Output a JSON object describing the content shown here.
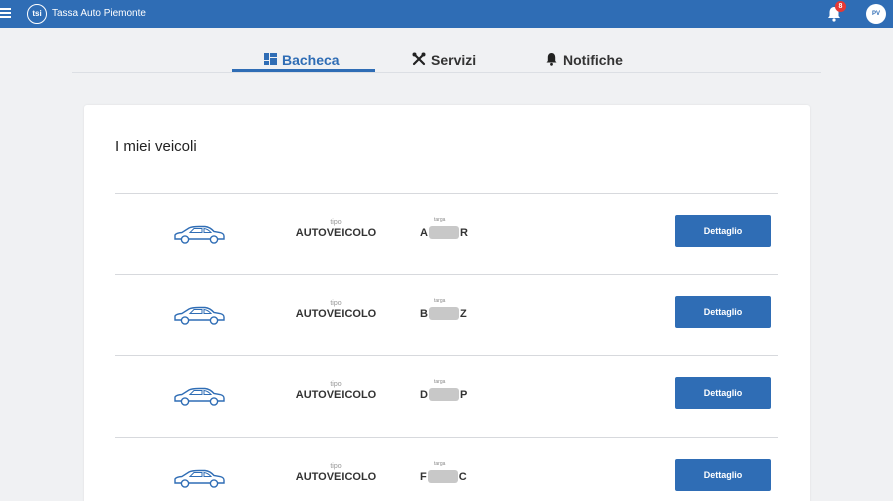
{
  "header": {
    "logo_text": "tsi",
    "app_title": "Tassa Auto Piemonte",
    "notification_count": "8",
    "avatar_initials": "PV",
    "color": "#2f6db5"
  },
  "tabs": [
    {
      "label": "Bacheca",
      "icon": "dashboard-icon",
      "active": true
    },
    {
      "label": "Servizi",
      "icon": "tools-icon",
      "active": false
    },
    {
      "label": "Notifiche",
      "icon": "bell-icon",
      "active": false
    }
  ],
  "main": {
    "title": "I miei veicoli",
    "vehicles": [
      {
        "tipo_label": "tipo",
        "tipo": "AUTOVEICOLO",
        "targa_label": "targa",
        "targa_prefix": "A",
        "targa_suffix": "R",
        "button": "Dettaglio"
      },
      {
        "tipo_label": "tipo",
        "tipo": "AUTOVEICOLO",
        "targa_label": "targa",
        "targa_prefix": "B",
        "targa_suffix": "Z",
        "button": "Dettaglio"
      },
      {
        "tipo_label": "tipo",
        "tipo": "AUTOVEICOLO",
        "targa_label": "targa",
        "targa_prefix": "D",
        "targa_suffix": "P",
        "button": "Dettaglio"
      },
      {
        "tipo_label": "tipo",
        "tipo": "AUTOVEICOLO",
        "targa_label": "targa",
        "targa_prefix": "F",
        "targa_suffix": "C",
        "button": "Dettaglio"
      }
    ]
  }
}
